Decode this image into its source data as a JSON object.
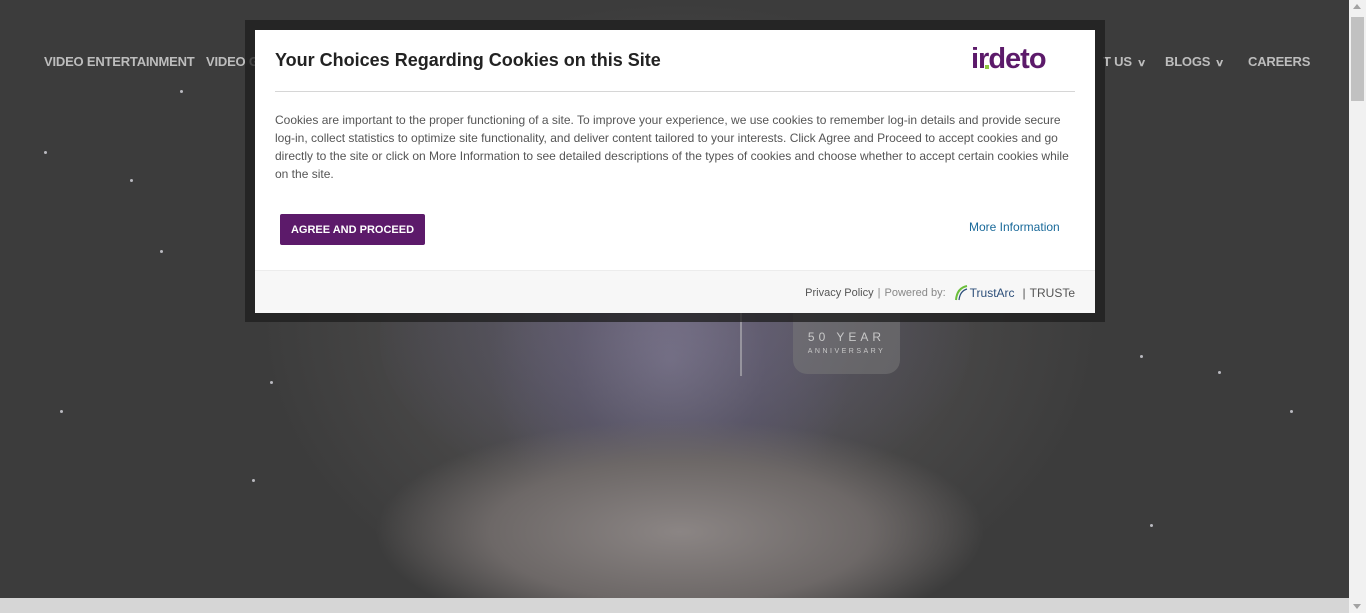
{
  "nav": {
    "items": [
      {
        "label": "VIDEO ENTERTAINMENT",
        "dropdown": false
      },
      {
        "label": "VIDEO GA",
        "dropdown": false
      },
      {
        "label": "T US",
        "dropdown": true
      },
      {
        "label": "BLOGS",
        "dropdown": true
      },
      {
        "label": "CAREERS",
        "dropdown": false
      }
    ]
  },
  "hero": {
    "anniversary_year": "50 YEAR",
    "anniversary_sub": "ANNIVERSARY"
  },
  "modal": {
    "title": "Your Choices Regarding Cookies on this Site",
    "logo_text": "irdeto",
    "body": "Cookies are important to the proper functioning of a site. To improve your experience, we use cookies to remember log-in details and provide secure log-in, collect statistics to optimize site functionality, and deliver content tailored to your interests. Click Agree and Proceed to accept cookies and go directly to the site or click on More Information to see detailed descriptions of the types of cookies and choose whether to accept certain cookies while on the site.",
    "agree_label": "AGREE AND PROCEED",
    "more_info_label": "More Information",
    "footer": {
      "privacy_label": "Privacy Policy",
      "separator": "|",
      "powered_by": "Powered by:",
      "trustarc": "TrustArc",
      "pipe": "|",
      "truste": "TRUSTe"
    }
  },
  "colors": {
    "accent": "#5c1a6a",
    "link": "#1a6a9a",
    "logo_green": "#8dc63f"
  }
}
